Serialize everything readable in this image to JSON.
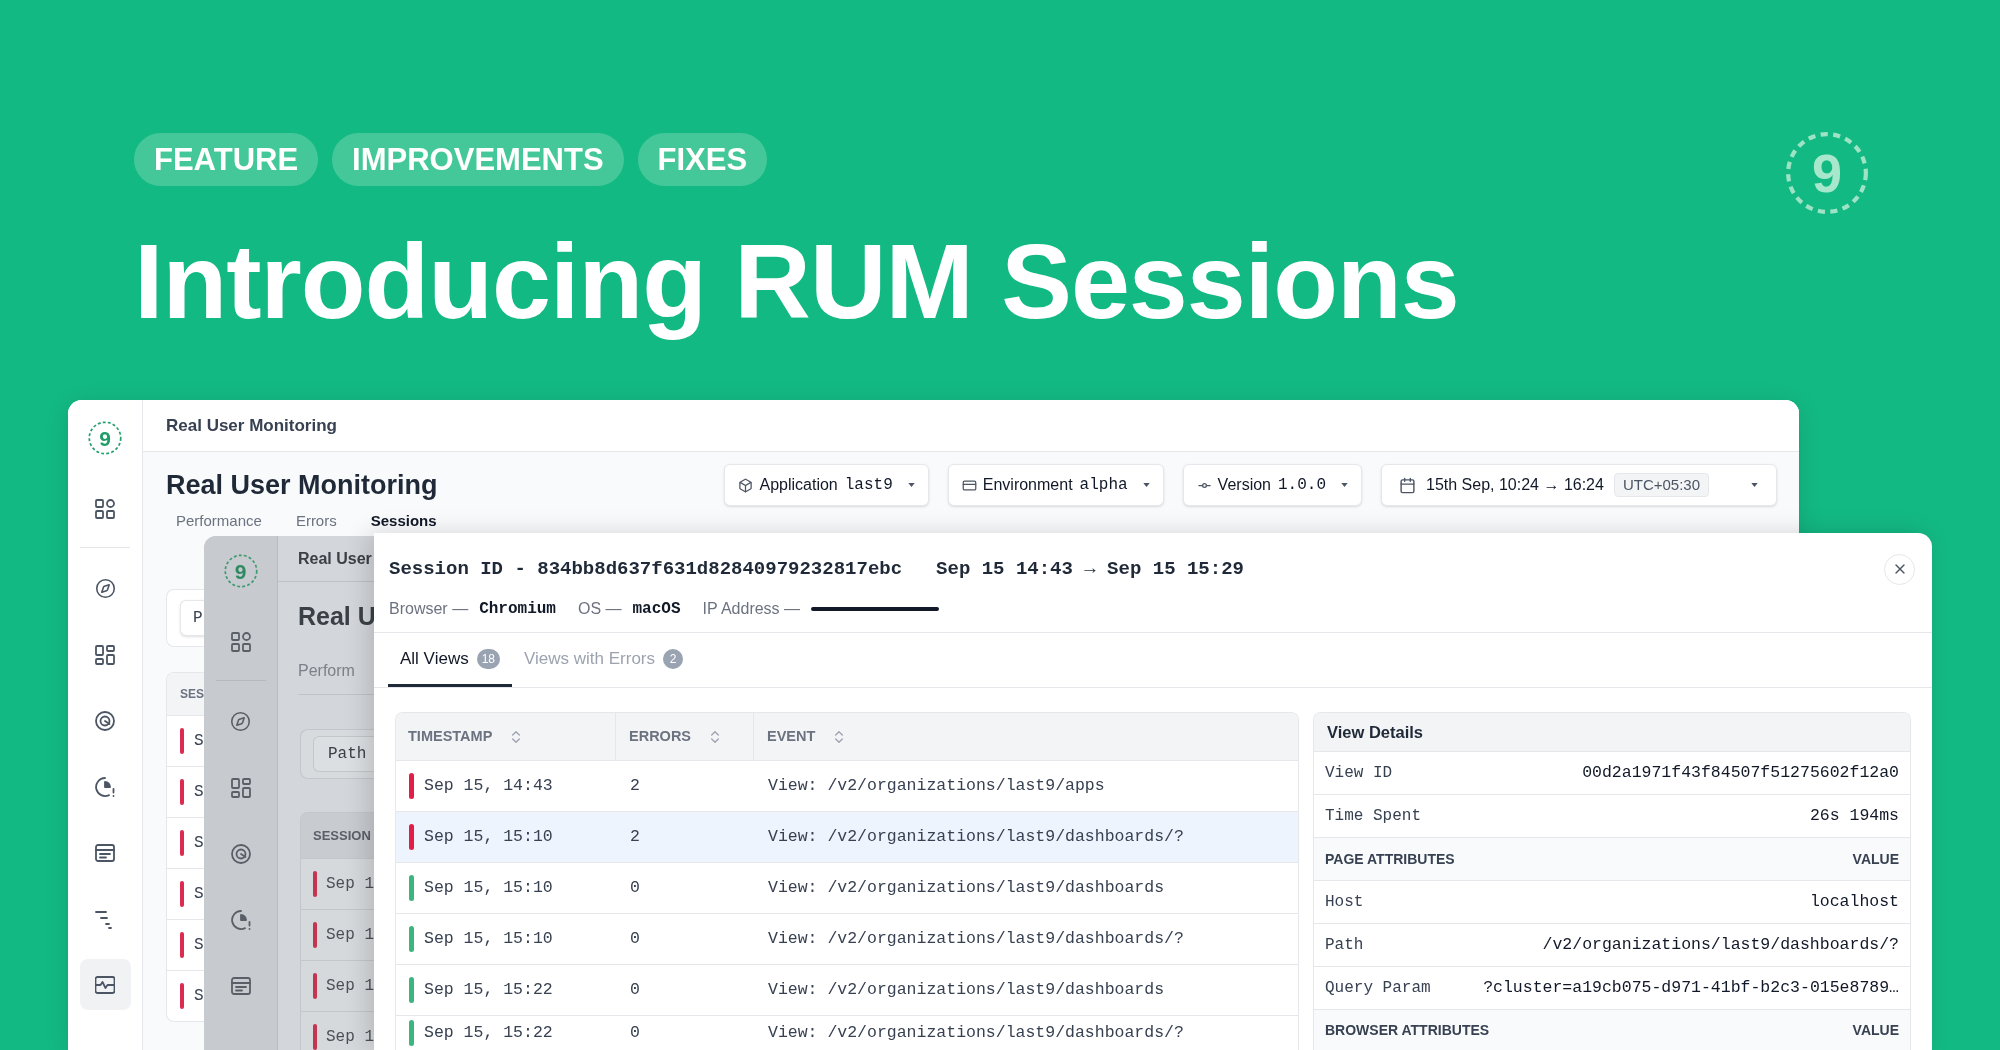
{
  "tags": [
    "FEATURE",
    "IMPROVEMENTS",
    "FIXES"
  ],
  "headline": "Introducing RUM Sessions",
  "logo": "9",
  "back_window": {
    "logo": "9",
    "sidebar": [
      {
        "selected": false
      },
      {
        "selected": false
      },
      {
        "selected": false
      },
      {
        "selected": false
      },
      {
        "selected": false
      },
      {
        "selected": false
      },
      {
        "selected": false
      },
      {
        "selected": true
      }
    ],
    "breadcrumb": "Real User Monitoring",
    "title": "Real User Monitoring",
    "filters": [
      {
        "kind": "application",
        "label": "Application",
        "value": "last9"
      },
      {
        "kind": "environment",
        "label": "Environment",
        "value": "alpha"
      },
      {
        "kind": "version",
        "label": "Version",
        "value": "1.0.0"
      }
    ],
    "date_range": {
      "range": "15th Sep, 10:24 → 16:24",
      "timezone": "UTC+05:30"
    },
    "tabs": [
      {
        "label": "Performance",
        "selected": false
      },
      {
        "label": "Errors",
        "selected": false
      },
      {
        "label": "Sessions",
        "selected": true
      }
    ],
    "filter_button": "P",
    "table_header": "SES",
    "rows": [
      {
        "text": "S",
        "color": "#dc2a50"
      },
      {
        "text": "S",
        "color": "#dc2a50"
      },
      {
        "text": "S",
        "color": "#dc2a50"
      },
      {
        "text": "S",
        "color": "#dc2a50"
      },
      {
        "text": "S",
        "color": "#dc2a50"
      },
      {
        "text": "S",
        "color": "#dc2a50"
      }
    ]
  },
  "middle_window": {
    "logo": "9",
    "breadcrumb": "Real User",
    "title": "Real U",
    "tab": "Perform",
    "filter_button": "Path",
    "table_header": "SESSION",
    "rows": [
      {
        "text": "Sep 1",
        "color": "#c43552"
      },
      {
        "text": "Sep 1",
        "color": "#c43552"
      },
      {
        "text": "Sep 1",
        "color": "#c43552"
      },
      {
        "text": "Sep 1",
        "color": "#c43552"
      }
    ]
  },
  "session_panel": {
    "title": "Session ID - 834bb8d637f631d82840979232817ebc",
    "time_range": "Sep 15 14:43 → Sep 15 15:29",
    "meta": [
      {
        "kind": "text",
        "label": "Browser —",
        "value": "Chromium"
      },
      {
        "kind": "text",
        "label": "OS —",
        "value": "macOS"
      },
      {
        "kind": "redacted",
        "label": "IP Address —"
      }
    ],
    "tabs": [
      {
        "label": "All Views",
        "count": "18",
        "selected": true
      },
      {
        "label": "Views with Errors",
        "count": "2",
        "selected": false
      }
    ],
    "table": {
      "columns": [
        "TIMESTAMP",
        "ERRORS",
        "EVENT"
      ],
      "rows": [
        {
          "timestamp": "Sep 15, 14:43",
          "errors": "2",
          "event": "View: /v2/organizations/last9/apps",
          "color": "#e11d48",
          "selected": false
        },
        {
          "timestamp": "Sep 15, 15:10",
          "errors": "2",
          "event": "View: /v2/organizations/last9/dashboards/?",
          "color": "#e11d48",
          "selected": true
        },
        {
          "timestamp": "Sep 15, 15:10",
          "errors": "0",
          "event": "View: /v2/organizations/last9/dashboards",
          "color": "#3db57f",
          "selected": false
        },
        {
          "timestamp": "Sep 15, 15:10",
          "errors": "0",
          "event": "View: /v2/organizations/last9/dashboards/?",
          "color": "#3db57f",
          "selected": false
        },
        {
          "timestamp": "Sep 15, 15:22",
          "errors": "0",
          "event": "View: /v2/organizations/last9/dashboards",
          "color": "#3db57f",
          "selected": false
        },
        {
          "timestamp": "Sep 15, 15:22",
          "errors": "0",
          "event": "View: /v2/organizations/last9/dashboards/?",
          "color": "#3db57f",
          "selected": false
        }
      ]
    },
    "view_details": {
      "title": "View Details",
      "rows": [
        {
          "kind": "field",
          "label": "View ID",
          "value": "00d2a1971f43f84507f51275602f12a0"
        },
        {
          "kind": "field",
          "label": "Time Spent",
          "value": "26s 194ms"
        },
        {
          "kind": "section",
          "label": "PAGE ATTRIBUTES",
          "value": "VALUE"
        },
        {
          "kind": "field",
          "label": "Host",
          "value": "localhost"
        },
        {
          "kind": "field",
          "label": "Path",
          "value": "/v2/organizations/last9/dashboards/?"
        },
        {
          "kind": "field",
          "label": "Query Param",
          "value": "?cluster=a19cb075-d971-41bf-b2c3-015e8789…"
        },
        {
          "kind": "section",
          "label": "BROWSER ATTRIBUTES",
          "value": "VALUE"
        }
      ]
    }
  }
}
